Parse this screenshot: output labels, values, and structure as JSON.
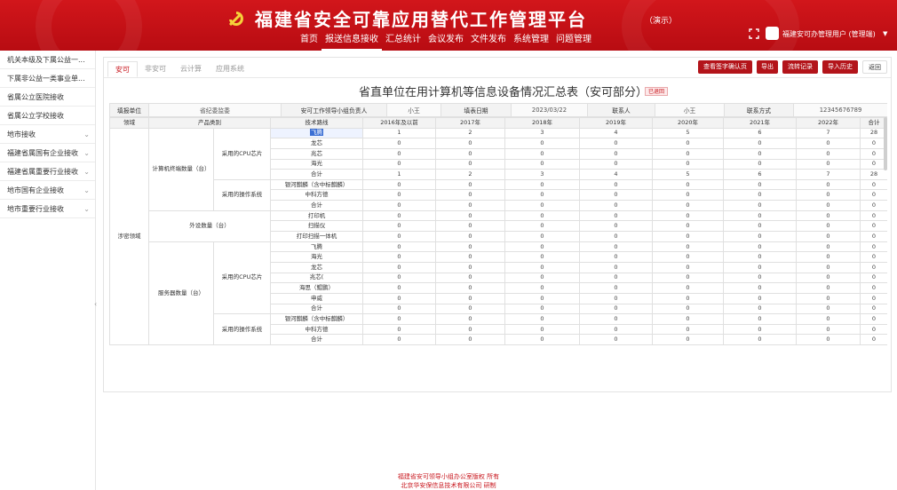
{
  "header": {
    "title": "福建省安全可靠应用替代工作管理平台",
    "title_tag": "（演示）",
    "nav": [
      "首页",
      "报送信息接收",
      "汇总统计",
      "会议发布",
      "文件发布",
      "系统管理",
      "问题管理"
    ],
    "nav_active": 1,
    "user": "福建安可办管理用户 (管理端)"
  },
  "sidebar": {
    "items": [
      {
        "label": "机关本级及下属公益一...",
        "arrow": ""
      },
      {
        "label": "下属非公益一类事业单...",
        "arrow": ""
      },
      {
        "label": "省属公立医院接收",
        "arrow": ""
      },
      {
        "label": "省属公立学校接收",
        "arrow": ""
      },
      {
        "label": "地市接收",
        "arrow": "⌄"
      },
      {
        "label": "福建省属国有企业接收",
        "arrow": "⌄"
      },
      {
        "label": "福建省属重要行业接收",
        "arrow": "⌄"
      },
      {
        "label": "地市国有企业接收",
        "arrow": "⌄"
      },
      {
        "label": "地市重要行业接收",
        "arrow": "⌄"
      }
    ]
  },
  "main": {
    "tabs": [
      "安可",
      "非安可",
      "云计算",
      "应用系统"
    ],
    "actions": [
      "查看签字确认页",
      "导出",
      "流转记录",
      "导入历史",
      "返回"
    ],
    "report_title": "省直单位在用计算机等信息设备情况汇总表（安可部分）",
    "report_badge": "已退回",
    "info": {
      "unit_label": "填报单位",
      "unit_value": "省纪委监委",
      "leader_label": "安可工作领导小组负责人",
      "leader_value": "小王",
      "date_label": "填表日期",
      "date_value": "2023/03/22",
      "contact_label": "联系人",
      "contact_value": "小王",
      "phone_label": "联系方式",
      "phone_value": "12345676789"
    },
    "head": {
      "field": "领域",
      "product": "产品类别",
      "tech": "技术路线",
      "years": [
        "2016年及以前",
        "2017年",
        "2018年",
        "2019年",
        "2020年",
        "2021年",
        "2022年",
        "合计"
      ]
    },
    "field_name": "涉密领域",
    "groups": [
      {
        "name": "计算机终端数量（台）",
        "subs": [
          {
            "name": "采用的CPU芯片",
            "rows": [
              {
                "tech": "飞腾",
                "vals": [
                  "1",
                  "2",
                  "3",
                  "4",
                  "5",
                  "6",
                  "7",
                  "28"
                ],
                "sel": true
              },
              {
                "tech": "龙芯",
                "vals": [
                  "0",
                  "0",
                  "0",
                  "0",
                  "0",
                  "0",
                  "0",
                  "0"
                ]
              },
              {
                "tech": "兆芯",
                "vals": [
                  "0",
                  "0",
                  "0",
                  "0",
                  "0",
                  "0",
                  "0",
                  "0"
                ]
              },
              {
                "tech": "海光",
                "vals": [
                  "0",
                  "0",
                  "0",
                  "0",
                  "0",
                  "0",
                  "0",
                  "0"
                ]
              },
              {
                "tech": "合计",
                "vals": [
                  "1",
                  "2",
                  "3",
                  "4",
                  "5",
                  "6",
                  "7",
                  "28"
                ]
              }
            ]
          },
          {
            "name": "采用的操作系统",
            "rows": [
              {
                "tech": "银河麒麟（含中标麒麟）",
                "vals": [
                  "0",
                  "0",
                  "0",
                  "0",
                  "0",
                  "0",
                  "0",
                  "0"
                ]
              },
              {
                "tech": "中科方德",
                "vals": [
                  "0",
                  "0",
                  "0",
                  "0",
                  "0",
                  "0",
                  "0",
                  "0"
                ]
              },
              {
                "tech": "合计",
                "vals": [
                  "0",
                  "0",
                  "0",
                  "0",
                  "0",
                  "0",
                  "0",
                  "0"
                ]
              }
            ]
          }
        ]
      },
      {
        "name": "外设数量（台）",
        "subs": [
          {
            "name": "",
            "rows": [
              {
                "tech": "打印机",
                "vals": [
                  "0",
                  "0",
                  "0",
                  "0",
                  "0",
                  "0",
                  "0",
                  "0"
                ]
              },
              {
                "tech": "扫描仪",
                "vals": [
                  "0",
                  "0",
                  "0",
                  "0",
                  "0",
                  "0",
                  "0",
                  "0"
                ]
              },
              {
                "tech": "打印扫描一体机",
                "vals": [
                  "0",
                  "0",
                  "0",
                  "0",
                  "0",
                  "0",
                  "0",
                  "0"
                ]
              }
            ]
          }
        ]
      },
      {
        "name": "服务器数量（台）",
        "subs": [
          {
            "name": "采用的CPU芯片",
            "rows": [
              {
                "tech": "飞腾",
                "vals": [
                  "0",
                  "0",
                  "0",
                  "0",
                  "0",
                  "0",
                  "0",
                  "0"
                ]
              },
              {
                "tech": "海光",
                "vals": [
                  "0",
                  "0",
                  "0",
                  "0",
                  "0",
                  "0",
                  "0",
                  "0"
                ]
              },
              {
                "tech": "龙芯",
                "vals": [
                  "0",
                  "0",
                  "0",
                  "0",
                  "0",
                  "0",
                  "0",
                  "0"
                ]
              },
              {
                "tech": "兆芯(",
                "vals": [
                  "0",
                  "0",
                  "0",
                  "0",
                  "0",
                  "0",
                  "0",
                  "0"
                ]
              },
              {
                "tech": "海思（鲲鹏）",
                "vals": [
                  "0",
                  "0",
                  "0",
                  "0",
                  "0",
                  "0",
                  "0",
                  "0"
                ]
              },
              {
                "tech": "申威",
                "vals": [
                  "0",
                  "0",
                  "0",
                  "0",
                  "0",
                  "0",
                  "0",
                  "0"
                ]
              },
              {
                "tech": "合计",
                "vals": [
                  "0",
                  "0",
                  "0",
                  "0",
                  "0",
                  "0",
                  "0",
                  "0"
                ]
              }
            ]
          },
          {
            "name": "采用的操作系统",
            "rows": [
              {
                "tech": "银河麒麟（含中标麒麟）",
                "vals": [
                  "0",
                  "0",
                  "0",
                  "0",
                  "0",
                  "0",
                  "0",
                  "0"
                ]
              },
              {
                "tech": "中科方德",
                "vals": [
                  "0",
                  "0",
                  "0",
                  "0",
                  "0",
                  "0",
                  "0",
                  "0"
                ]
              },
              {
                "tech": "合计",
                "vals": [
                  "0",
                  "0",
                  "0",
                  "0",
                  "0",
                  "0",
                  "0",
                  "0"
                ]
              }
            ]
          }
        ]
      }
    ]
  },
  "footer": {
    "line1": "福建省安可领导小组办公室版权 所有",
    "line2": "北京华安保信息技术有限公司 研制"
  }
}
